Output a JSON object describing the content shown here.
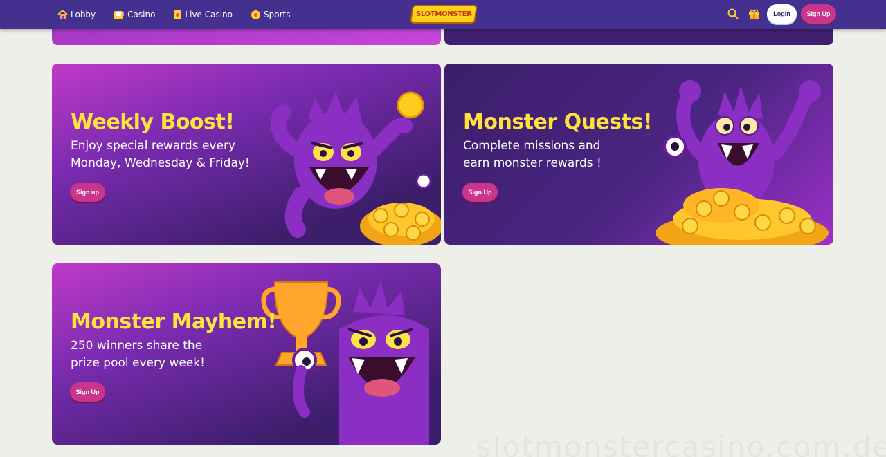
{
  "nav": {
    "items": [
      {
        "label": "Lobby",
        "icon": "home-icon"
      },
      {
        "label": "Casino",
        "icon": "slot-machine-icon"
      },
      {
        "label": "Live Casino",
        "icon": "card-icon"
      },
      {
        "label": "Sports",
        "icon": "ball-icon"
      }
    ],
    "logo_text": "SLOTMONSTER",
    "login_label": "Login",
    "signup_label": "Sign Up"
  },
  "promos": [
    {
      "title": "Weekly Boost!",
      "line1": "Enjoy special rewards every",
      "line2": "Monday, Wednesday & Friday!",
      "button": "Sign up"
    },
    {
      "title": "Monster Quests!",
      "line1": "Complete missions and",
      "line2": "earn monster rewards !",
      "button": "Sign Up"
    },
    {
      "title": "Monster Mayhem!",
      "line1": "250 winners share the",
      "line2": "prize pool every week!",
      "button": "Sign Up"
    }
  ],
  "watermark": "slotmonstercasino.com.de",
  "colors": {
    "header": "#43308f",
    "title": "#ffe33d",
    "button": "#c9358c",
    "background": "#efefea"
  }
}
